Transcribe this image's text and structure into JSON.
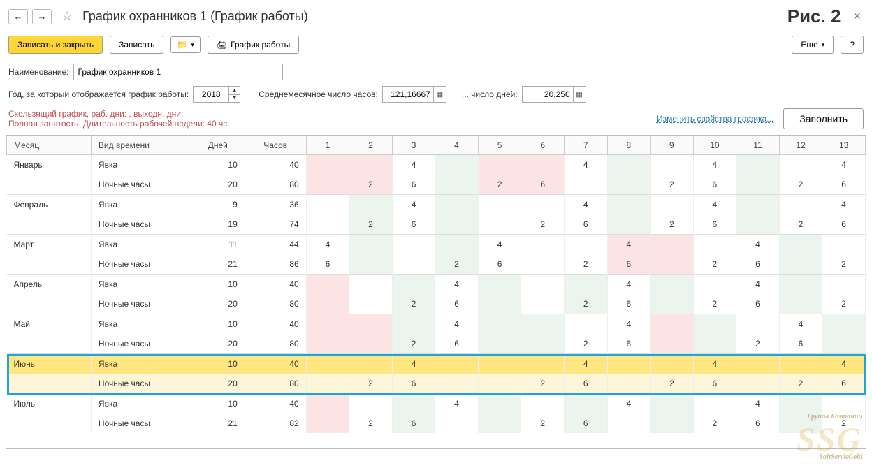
{
  "header": {
    "title": "График охранников 1 (График работы)",
    "figure": "Рис. 2"
  },
  "toolbar": {
    "save_close": "Записать и закрыть",
    "save": "Записать",
    "print": "График работы",
    "more": "Еще",
    "help": "?"
  },
  "form": {
    "name_label": "Наименование:",
    "name_value": "График охранников 1",
    "year_label": "Год, за который отображается график работы:",
    "year_value": "2018",
    "avg_hours_label": "Среднемесячное число часов:",
    "avg_hours_value": "121,16667",
    "avg_days_label": "... число дней:",
    "avg_days_value": "20,250"
  },
  "info": {
    "line1": "Скользящий график, раб. дни: , выходн. дни:",
    "line2": "Полная занятость. Длительность рабочей недели: 40 чс.",
    "edit_link": "Изменить свойства графика...",
    "fill": "Заполнить"
  },
  "cols": {
    "month": "Месяц",
    "type": "Вид времени",
    "days": "Дней",
    "hours": "Часов",
    "d": [
      "1",
      "2",
      "3",
      "4",
      "5",
      "6",
      "7",
      "8",
      "9",
      "10",
      "11",
      "12",
      "13"
    ]
  },
  "selectedMonth": "Июнь",
  "rows": [
    {
      "month": "Январь",
      "type": "Явка",
      "days": "10",
      "hours": "40",
      "cells": [
        {
          "v": "",
          "c": "pink"
        },
        {
          "v": "",
          "c": "pink"
        },
        {
          "v": "4",
          "c": ""
        },
        {
          "v": "",
          "c": "green"
        },
        {
          "v": "",
          "c": "pink"
        },
        {
          "v": "",
          "c": "pink"
        },
        {
          "v": "4",
          "c": ""
        },
        {
          "v": "",
          "c": "green"
        },
        {
          "v": "",
          "c": ""
        },
        {
          "v": "4",
          "c": ""
        },
        {
          "v": "",
          "c": "green"
        },
        {
          "v": "",
          "c": ""
        },
        {
          "v": "4",
          "c": ""
        }
      ]
    },
    {
      "month": "",
      "type": "Ночные часы",
      "days": "20",
      "hours": "80",
      "cells": [
        {
          "v": "",
          "c": "pink"
        },
        {
          "v": "2",
          "c": "pink"
        },
        {
          "v": "6",
          "c": ""
        },
        {
          "v": "",
          "c": "green"
        },
        {
          "v": "2",
          "c": "pink"
        },
        {
          "v": "6",
          "c": "pink"
        },
        {
          "v": "",
          "c": ""
        },
        {
          "v": "",
          "c": "green"
        },
        {
          "v": "2",
          "c": ""
        },
        {
          "v": "6",
          "c": ""
        },
        {
          "v": "",
          "c": "green"
        },
        {
          "v": "2",
          "c": ""
        },
        {
          "v": "6",
          "c": ""
        }
      ]
    },
    {
      "month": "Февраль",
      "type": "Явка",
      "days": "9",
      "hours": "36",
      "cells": [
        {
          "v": "",
          "c": ""
        },
        {
          "v": "",
          "c": "green"
        },
        {
          "v": "4",
          "c": ""
        },
        {
          "v": "",
          "c": "green"
        },
        {
          "v": "",
          "c": ""
        },
        {
          "v": "",
          "c": ""
        },
        {
          "v": "4",
          "c": ""
        },
        {
          "v": "",
          "c": "green"
        },
        {
          "v": "",
          "c": ""
        },
        {
          "v": "4",
          "c": ""
        },
        {
          "v": "",
          "c": "green"
        },
        {
          "v": "",
          "c": ""
        },
        {
          "v": "4",
          "c": ""
        }
      ]
    },
    {
      "month": "",
      "type": "Ночные часы",
      "days": "19",
      "hours": "74",
      "cells": [
        {
          "v": "",
          "c": ""
        },
        {
          "v": "2",
          "c": "green"
        },
        {
          "v": "6",
          "c": ""
        },
        {
          "v": "",
          "c": "green"
        },
        {
          "v": "",
          "c": ""
        },
        {
          "v": "2",
          "c": ""
        },
        {
          "v": "6",
          "c": ""
        },
        {
          "v": "",
          "c": "green"
        },
        {
          "v": "2",
          "c": ""
        },
        {
          "v": "6",
          "c": ""
        },
        {
          "v": "",
          "c": "green"
        },
        {
          "v": "2",
          "c": ""
        },
        {
          "v": "6",
          "c": ""
        }
      ]
    },
    {
      "month": "Март",
      "type": "Явка",
      "days": "11",
      "hours": "44",
      "cells": [
        {
          "v": "4",
          "c": ""
        },
        {
          "v": "",
          "c": "green"
        },
        {
          "v": "",
          "c": ""
        },
        {
          "v": "",
          "c": "green"
        },
        {
          "v": "4",
          "c": ""
        },
        {
          "v": "",
          "c": ""
        },
        {
          "v": "",
          "c": ""
        },
        {
          "v": "4",
          "c": "pink"
        },
        {
          "v": "",
          "c": "pink"
        },
        {
          "v": "",
          "c": ""
        },
        {
          "v": "4",
          "c": ""
        },
        {
          "v": "",
          "c": "green"
        },
        {
          "v": "",
          "c": ""
        }
      ]
    },
    {
      "month": "",
      "type": "Ночные часы",
      "days": "21",
      "hours": "86",
      "cells": [
        {
          "v": "6",
          "c": ""
        },
        {
          "v": "",
          "c": "green"
        },
        {
          "v": "",
          "c": ""
        },
        {
          "v": "2",
          "c": "green"
        },
        {
          "v": "6",
          "c": ""
        },
        {
          "v": "",
          "c": ""
        },
        {
          "v": "2",
          "c": ""
        },
        {
          "v": "6",
          "c": "pink"
        },
        {
          "v": "",
          "c": "pink"
        },
        {
          "v": "2",
          "c": ""
        },
        {
          "v": "6",
          "c": ""
        },
        {
          "v": "",
          "c": "green"
        },
        {
          "v": "2",
          "c": ""
        }
      ]
    },
    {
      "month": "Апрель",
      "type": "Явка",
      "days": "10",
      "hours": "40",
      "cells": [
        {
          "v": "",
          "c": "pink"
        },
        {
          "v": "",
          "c": ""
        },
        {
          "v": "",
          "c": "green"
        },
        {
          "v": "4",
          "c": ""
        },
        {
          "v": "",
          "c": "green"
        },
        {
          "v": "",
          "c": ""
        },
        {
          "v": "",
          "c": "green"
        },
        {
          "v": "4",
          "c": ""
        },
        {
          "v": "",
          "c": "green"
        },
        {
          "v": "",
          "c": ""
        },
        {
          "v": "4",
          "c": ""
        },
        {
          "v": "",
          "c": "green"
        },
        {
          "v": "",
          "c": ""
        }
      ]
    },
    {
      "month": "",
      "type": "Ночные часы",
      "days": "20",
      "hours": "80",
      "cells": [
        {
          "v": "",
          "c": "pink"
        },
        {
          "v": "",
          "c": ""
        },
        {
          "v": "2",
          "c": "green"
        },
        {
          "v": "6",
          "c": ""
        },
        {
          "v": "",
          "c": "green"
        },
        {
          "v": "",
          "c": ""
        },
        {
          "v": "2",
          "c": "green"
        },
        {
          "v": "6",
          "c": ""
        },
        {
          "v": "",
          "c": "green"
        },
        {
          "v": "2",
          "c": ""
        },
        {
          "v": "6",
          "c": ""
        },
        {
          "v": "",
          "c": "green"
        },
        {
          "v": "2",
          "c": ""
        }
      ]
    },
    {
      "month": "Май",
      "type": "Явка",
      "days": "10",
      "hours": "40",
      "cells": [
        {
          "v": "",
          "c": "pink"
        },
        {
          "v": "",
          "c": "pink"
        },
        {
          "v": "",
          "c": "green"
        },
        {
          "v": "4",
          "c": ""
        },
        {
          "v": "",
          "c": "green"
        },
        {
          "v": "",
          "c": "green"
        },
        {
          "v": "",
          "c": ""
        },
        {
          "v": "4",
          "c": ""
        },
        {
          "v": "",
          "c": "pink"
        },
        {
          "v": "",
          "c": "green"
        },
        {
          "v": "",
          "c": ""
        },
        {
          "v": "4",
          "c": ""
        },
        {
          "v": "",
          "c": "green"
        }
      ]
    },
    {
      "month": "",
      "type": "Ночные часы",
      "days": "20",
      "hours": "80",
      "cells": [
        {
          "v": "",
          "c": "pink"
        },
        {
          "v": "",
          "c": "pink"
        },
        {
          "v": "2",
          "c": "green"
        },
        {
          "v": "6",
          "c": ""
        },
        {
          "v": "",
          "c": "green"
        },
        {
          "v": "",
          "c": "green"
        },
        {
          "v": "2",
          "c": ""
        },
        {
          "v": "6",
          "c": ""
        },
        {
          "v": "",
          "c": "pink"
        },
        {
          "v": "",
          "c": "green"
        },
        {
          "v": "2",
          "c": ""
        },
        {
          "v": "6",
          "c": ""
        },
        {
          "v": "",
          "c": "green"
        }
      ]
    },
    {
      "month": "Июнь",
      "type": "Явка",
      "days": "10",
      "hours": "40",
      "cells": [
        {
          "v": "",
          "c": ""
        },
        {
          "v": "",
          "c": "green"
        },
        {
          "v": "4",
          "c": ""
        },
        {
          "v": "",
          "c": "green"
        },
        {
          "v": "",
          "c": ""
        },
        {
          "v": "",
          "c": ""
        },
        {
          "v": "4",
          "c": ""
        },
        {
          "v": "",
          "c": ""
        },
        {
          "v": "",
          "c": ""
        },
        {
          "v": "4",
          "c": ""
        },
        {
          "v": "",
          "c": ""
        },
        {
          "v": "",
          "c": ""
        },
        {
          "v": "4",
          "c": ""
        }
      ]
    },
    {
      "month": "",
      "type": "Ночные часы",
      "days": "20",
      "hours": "80",
      "cells": [
        {
          "v": "",
          "c": ""
        },
        {
          "v": "2",
          "c": "green"
        },
        {
          "v": "6",
          "c": "pink"
        },
        {
          "v": "",
          "c": "green"
        },
        {
          "v": "",
          "c": ""
        },
        {
          "v": "2",
          "c": ""
        },
        {
          "v": "6",
          "c": ""
        },
        {
          "v": "",
          "c": ""
        },
        {
          "v": "2",
          "c": ""
        },
        {
          "v": "6",
          "c": ""
        },
        {
          "v": "",
          "c": ""
        },
        {
          "v": "2",
          "c": ""
        },
        {
          "v": "6",
          "c": "pink"
        }
      ]
    },
    {
      "month": "Июль",
      "type": "Явка",
      "days": "10",
      "hours": "40",
      "cells": [
        {
          "v": "",
          "c": "pink"
        },
        {
          "v": "",
          "c": ""
        },
        {
          "v": "",
          "c": "green"
        },
        {
          "v": "4",
          "c": ""
        },
        {
          "v": "",
          "c": "green"
        },
        {
          "v": "",
          "c": ""
        },
        {
          "v": "",
          "c": "green"
        },
        {
          "v": "4",
          "c": ""
        },
        {
          "v": "",
          "c": "green"
        },
        {
          "v": "",
          "c": ""
        },
        {
          "v": "4",
          "c": ""
        },
        {
          "v": "",
          "c": "green"
        },
        {
          "v": "",
          "c": ""
        }
      ]
    },
    {
      "month": "",
      "type": "Ночные часы",
      "days": "21",
      "hours": "82",
      "cells": [
        {
          "v": "",
          "c": "pink"
        },
        {
          "v": "2",
          "c": ""
        },
        {
          "v": "6",
          "c": "green"
        },
        {
          "v": "",
          "c": ""
        },
        {
          "v": "",
          "c": "green"
        },
        {
          "v": "2",
          "c": ""
        },
        {
          "v": "6",
          "c": "green"
        },
        {
          "v": "",
          "c": ""
        },
        {
          "v": "",
          "c": "green"
        },
        {
          "v": "2",
          "c": ""
        },
        {
          "v": "6",
          "c": ""
        },
        {
          "v": "",
          "c": "green"
        },
        {
          "v": "2",
          "c": ""
        }
      ]
    }
  ],
  "watermark": {
    "big": "SSG",
    "small1": "Группа Компаний",
    "small2": "SoftServisGold"
  }
}
